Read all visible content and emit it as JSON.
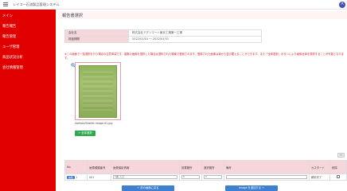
{
  "app": {
    "title": "レイコー石油製品管理システム",
    "user_initial": "A",
    "brand_color": "#e00000"
  },
  "sidebar": {
    "items": [
      {
        "label": "メイン"
      },
      {
        "label": "報告報告"
      },
      {
        "label": "報告管理"
      },
      {
        "label": "ユーザ管理"
      },
      {
        "label": "商品状況分析"
      },
      {
        "label": "会社情報管理"
      }
    ]
  },
  "page": {
    "title": "報告書選択"
  },
  "info": {
    "rows": [
      {
        "label": "会社名",
        "value": "株式会社アグリマート東京工場第一工場"
      },
      {
        "label": "検査期間",
        "value": "2022/01/01 〜 2022/01/31"
      }
    ]
  },
  "warning_text": "※この画面で一括選択を行う場合の注意事項です。複数の画像を選択した場合は選択された順番で登録されます。登録された画像は後から並び替えることができます。また「全体選択」ボタンにより画像全体を選択することが可能となります。",
  "image": {
    "filename": "Sample/Sheets image 01.jpg",
    "zoom_icon": "magnify-plus-icon"
  },
  "buttons": {
    "choose": "+ 全体選択",
    "small": "+",
    "add_left": "← 前の画面に戻る",
    "add_right": "Image を追加する →"
  },
  "table": {
    "headers": [
      "No.",
      "画像種類番号",
      "画像撮影情報",
      "設置箇所",
      "選択箇所",
      "備考",
      "カスタード",
      "削除"
    ],
    "rows": [
      {
        "action": "編集",
        "no": "1",
        "number": "001",
        "info": "1番 入口",
        "place": "5",
        "select": "1",
        "note": "",
        "status": "解析完了"
      }
    ]
  }
}
